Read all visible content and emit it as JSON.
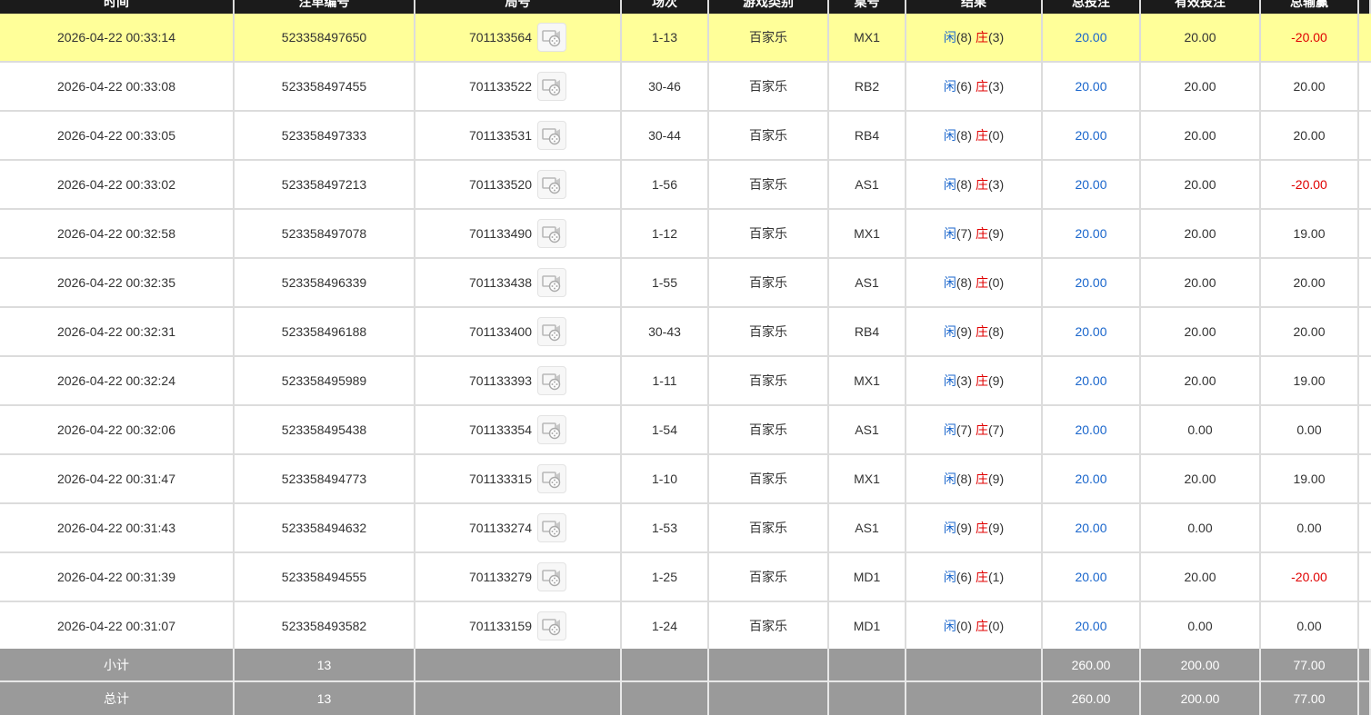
{
  "columns": [
    {
      "key": "time",
      "label": "时间"
    },
    {
      "key": "order_no",
      "label": "注单编号"
    },
    {
      "key": "round_no",
      "label": "局号"
    },
    {
      "key": "shoe",
      "label": "场次"
    },
    {
      "key": "game_type",
      "label": "游戏类别"
    },
    {
      "key": "table",
      "label": "桌号"
    },
    {
      "key": "result",
      "label": "结果"
    },
    {
      "key": "total_bet",
      "label": "总投注"
    },
    {
      "key": "valid_bet",
      "label": "有效投注"
    },
    {
      "key": "win_loss",
      "label": "总输赢"
    }
  ],
  "icons": {
    "replay": "video-replay-icon"
  },
  "colors": {
    "header_bg": "#1b1b1b",
    "highlight_row": "#ffff99",
    "footer_bg": "#9a9a9a",
    "player": "#1a66cc",
    "banker": "#e00000",
    "negative": "#e00000",
    "total_bet": "#1a66cc"
  },
  "labels": {
    "player": "闲",
    "banker": "庄"
  },
  "rows": [
    {
      "time": "2026-04-22 00:33:14",
      "order_no": "523358497650",
      "round_no": "701133564",
      "shoe": "1-13",
      "game_type": "百家乐",
      "table": "MX1",
      "player": "(8)",
      "banker": "(3)",
      "total_bet": "20.00",
      "valid_bet": "20.00",
      "win_loss": "-20.00",
      "highlighted": true
    },
    {
      "time": "2026-04-22 00:33:08",
      "order_no": "523358497455",
      "round_no": "701133522",
      "shoe": "30-46",
      "game_type": "百家乐",
      "table": "RB2",
      "player": "(6)",
      "banker": "(3)",
      "total_bet": "20.00",
      "valid_bet": "20.00",
      "win_loss": "20.00"
    },
    {
      "time": "2026-04-22 00:33:05",
      "order_no": "523358497333",
      "round_no": "701133531",
      "shoe": "30-44",
      "game_type": "百家乐",
      "table": "RB4",
      "player": "(8)",
      "banker": "(0)",
      "total_bet": "20.00",
      "valid_bet": "20.00",
      "win_loss": "20.00"
    },
    {
      "time": "2026-04-22 00:33:02",
      "order_no": "523358497213",
      "round_no": "701133520",
      "shoe": "1-56",
      "game_type": "百家乐",
      "table": "AS1",
      "player": "(8)",
      "banker": "(3)",
      "total_bet": "20.00",
      "valid_bet": "20.00",
      "win_loss": "-20.00"
    },
    {
      "time": "2026-04-22 00:32:58",
      "order_no": "523358497078",
      "round_no": "701133490",
      "shoe": "1-12",
      "game_type": "百家乐",
      "table": "MX1",
      "player": "(7)",
      "banker": "(9)",
      "total_bet": "20.00",
      "valid_bet": "20.00",
      "win_loss": "19.00"
    },
    {
      "time": "2026-04-22 00:32:35",
      "order_no": "523358496339",
      "round_no": "701133438",
      "shoe": "1-55",
      "game_type": "百家乐",
      "table": "AS1",
      "player": "(8)",
      "banker": "(0)",
      "total_bet": "20.00",
      "valid_bet": "20.00",
      "win_loss": "20.00"
    },
    {
      "time": "2026-04-22 00:32:31",
      "order_no": "523358496188",
      "round_no": "701133400",
      "shoe": "30-43",
      "game_type": "百家乐",
      "table": "RB4",
      "player": "(9)",
      "banker": "(8)",
      "total_bet": "20.00",
      "valid_bet": "20.00",
      "win_loss": "20.00"
    },
    {
      "time": "2026-04-22 00:32:24",
      "order_no": "523358495989",
      "round_no": "701133393",
      "shoe": "1-11",
      "game_type": "百家乐",
      "table": "MX1",
      "player": "(3)",
      "banker": "(9)",
      "total_bet": "20.00",
      "valid_bet": "20.00",
      "win_loss": "19.00"
    },
    {
      "time": "2026-04-22 00:32:06",
      "order_no": "523358495438",
      "round_no": "701133354",
      "shoe": "1-54",
      "game_type": "百家乐",
      "table": "AS1",
      "player": "(7)",
      "banker": "(7)",
      "total_bet": "20.00",
      "valid_bet": "0.00",
      "win_loss": "0.00"
    },
    {
      "time": "2026-04-22 00:31:47",
      "order_no": "523358494773",
      "round_no": "701133315",
      "shoe": "1-10",
      "game_type": "百家乐",
      "table": "MX1",
      "player": "(8)",
      "banker": "(9)",
      "total_bet": "20.00",
      "valid_bet": "20.00",
      "win_loss": "19.00"
    },
    {
      "time": "2026-04-22 00:31:43",
      "order_no": "523358494632",
      "round_no": "701133274",
      "shoe": "1-53",
      "game_type": "百家乐",
      "table": "AS1",
      "player": "(9)",
      "banker": "(9)",
      "total_bet": "20.00",
      "valid_bet": "0.00",
      "win_loss": "0.00"
    },
    {
      "time": "2026-04-22 00:31:39",
      "order_no": "523358494555",
      "round_no": "701133279",
      "shoe": "1-25",
      "game_type": "百家乐",
      "table": "MD1",
      "player": "(6)",
      "banker": "(1)",
      "total_bet": "20.00",
      "valid_bet": "20.00",
      "win_loss": "-20.00"
    },
    {
      "time": "2026-04-22 00:31:07",
      "order_no": "523358493582",
      "round_no": "701133159",
      "shoe": "1-24",
      "game_type": "百家乐",
      "table": "MD1",
      "player": "(0)",
      "banker": "(0)",
      "total_bet": "20.00",
      "valid_bet": "0.00",
      "win_loss": "0.00"
    }
  ],
  "subtotal": {
    "label": "小计",
    "count": "13",
    "total_bet": "260.00",
    "valid_bet": "200.00",
    "win_loss": "77.00"
  },
  "total": {
    "label": "总计",
    "count": "13",
    "total_bet": "260.00",
    "valid_bet": "200.00",
    "win_loss": "77.00"
  }
}
